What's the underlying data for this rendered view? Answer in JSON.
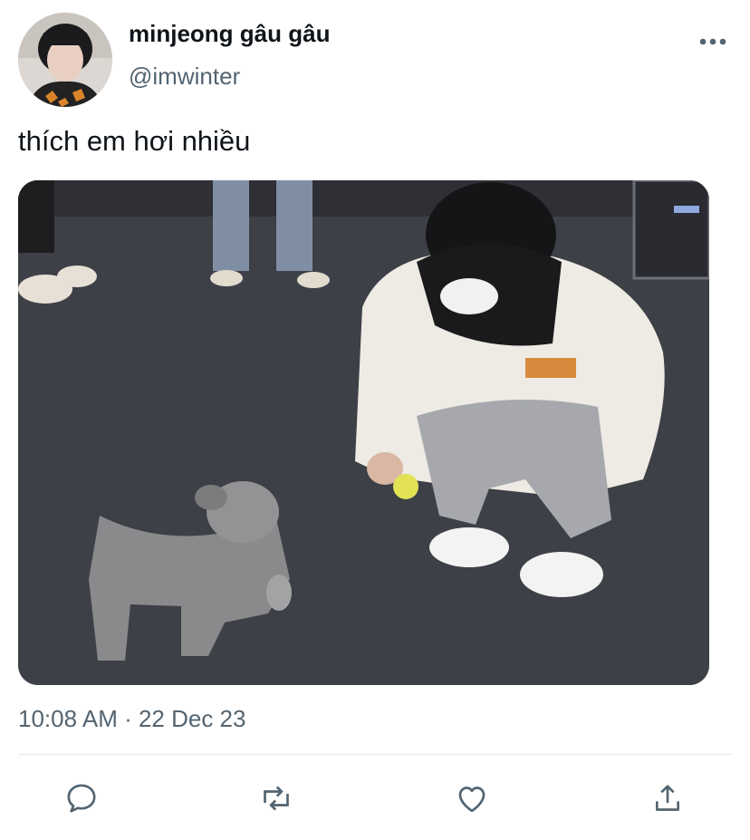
{
  "tweet": {
    "author_name": "minjeong gâu gâu",
    "author_handle": "@imwinter",
    "text": "thích em hơi nhiều",
    "timestamp": "10:08 AM · 22 Dec 23"
  },
  "icons": {
    "more": "more-horizontal-icon",
    "reply": "reply-icon",
    "retweet": "retweet-icon",
    "like": "heart-icon",
    "share": "share-icon"
  },
  "colors": {
    "text_primary": "#0f1419",
    "text_secondary": "#536471",
    "divider": "#e6e9ec"
  }
}
